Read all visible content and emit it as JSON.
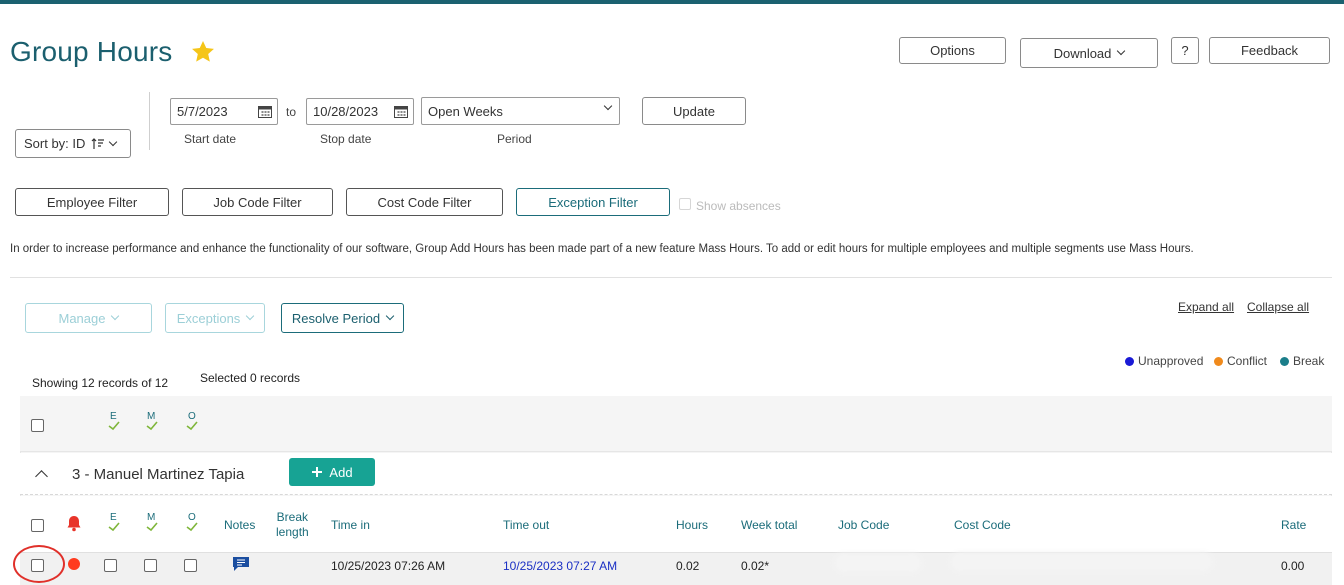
{
  "page": {
    "title": "Group Hours"
  },
  "header_buttons": {
    "options": "Options",
    "download": "Download",
    "help": "?",
    "feedback": "Feedback"
  },
  "sort": {
    "label": "Sort by: ID"
  },
  "date_range": {
    "start_value": "5/7/2023",
    "to_label": "to",
    "stop_value": "10/28/2023",
    "period_value": "Open Weeks",
    "start_label": "Start date",
    "stop_label": "Stop date",
    "period_label": "Period",
    "update_label": "Update"
  },
  "filters": {
    "employee": "Employee Filter",
    "job_code": "Job Code Filter",
    "cost_code": "Cost Code Filter",
    "exception": "Exception Filter",
    "show_absences": "Show absences"
  },
  "notice": "In order to increase performance and enhance the functionality of our software, Group Add Hours has been made part of a new feature Mass Hours. To add or edit hours for multiple employees and multiple segments use Mass Hours.",
  "actions": {
    "manage": "Manage",
    "exceptions": "Exceptions",
    "resolve_period": "Resolve Period",
    "expand_all": "Expand all",
    "collapse_all": "Collapse all"
  },
  "legend": [
    {
      "label": "Unapproved",
      "color": "#1a1ad6"
    },
    {
      "label": "Conflict",
      "color": "#f08a1c"
    },
    {
      "label": "Break",
      "color": "#1b7e8a"
    }
  ],
  "records": {
    "showing": "Showing 12 records of 12",
    "selected": "Selected 0 records"
  },
  "approval_columns": [
    "E",
    "M",
    "O"
  ],
  "employee": {
    "name": "3 - Manuel Martinez Tapia",
    "add_label": "Add"
  },
  "table": {
    "headers": {
      "notes": "Notes",
      "break_length_1": "Break",
      "break_length_2": "length",
      "time_in": "Time in",
      "time_out": "Time out",
      "hours": "Hours",
      "week_total": "Week total",
      "job_code": "Job Code",
      "cost_code": "Cost Code",
      "rate": "Rate"
    },
    "rows": [
      {
        "time_in": "10/25/2023 07:26 AM",
        "time_out": "10/25/2023 07:27 AM",
        "hours": "0.02",
        "week_total": "0.02*",
        "rate": "0.00"
      }
    ]
  },
  "colors": {
    "accent": "#1b5f6e",
    "add_button": "#17a394",
    "star": "#f5c518",
    "alert_dot": "#ff3b1f"
  }
}
